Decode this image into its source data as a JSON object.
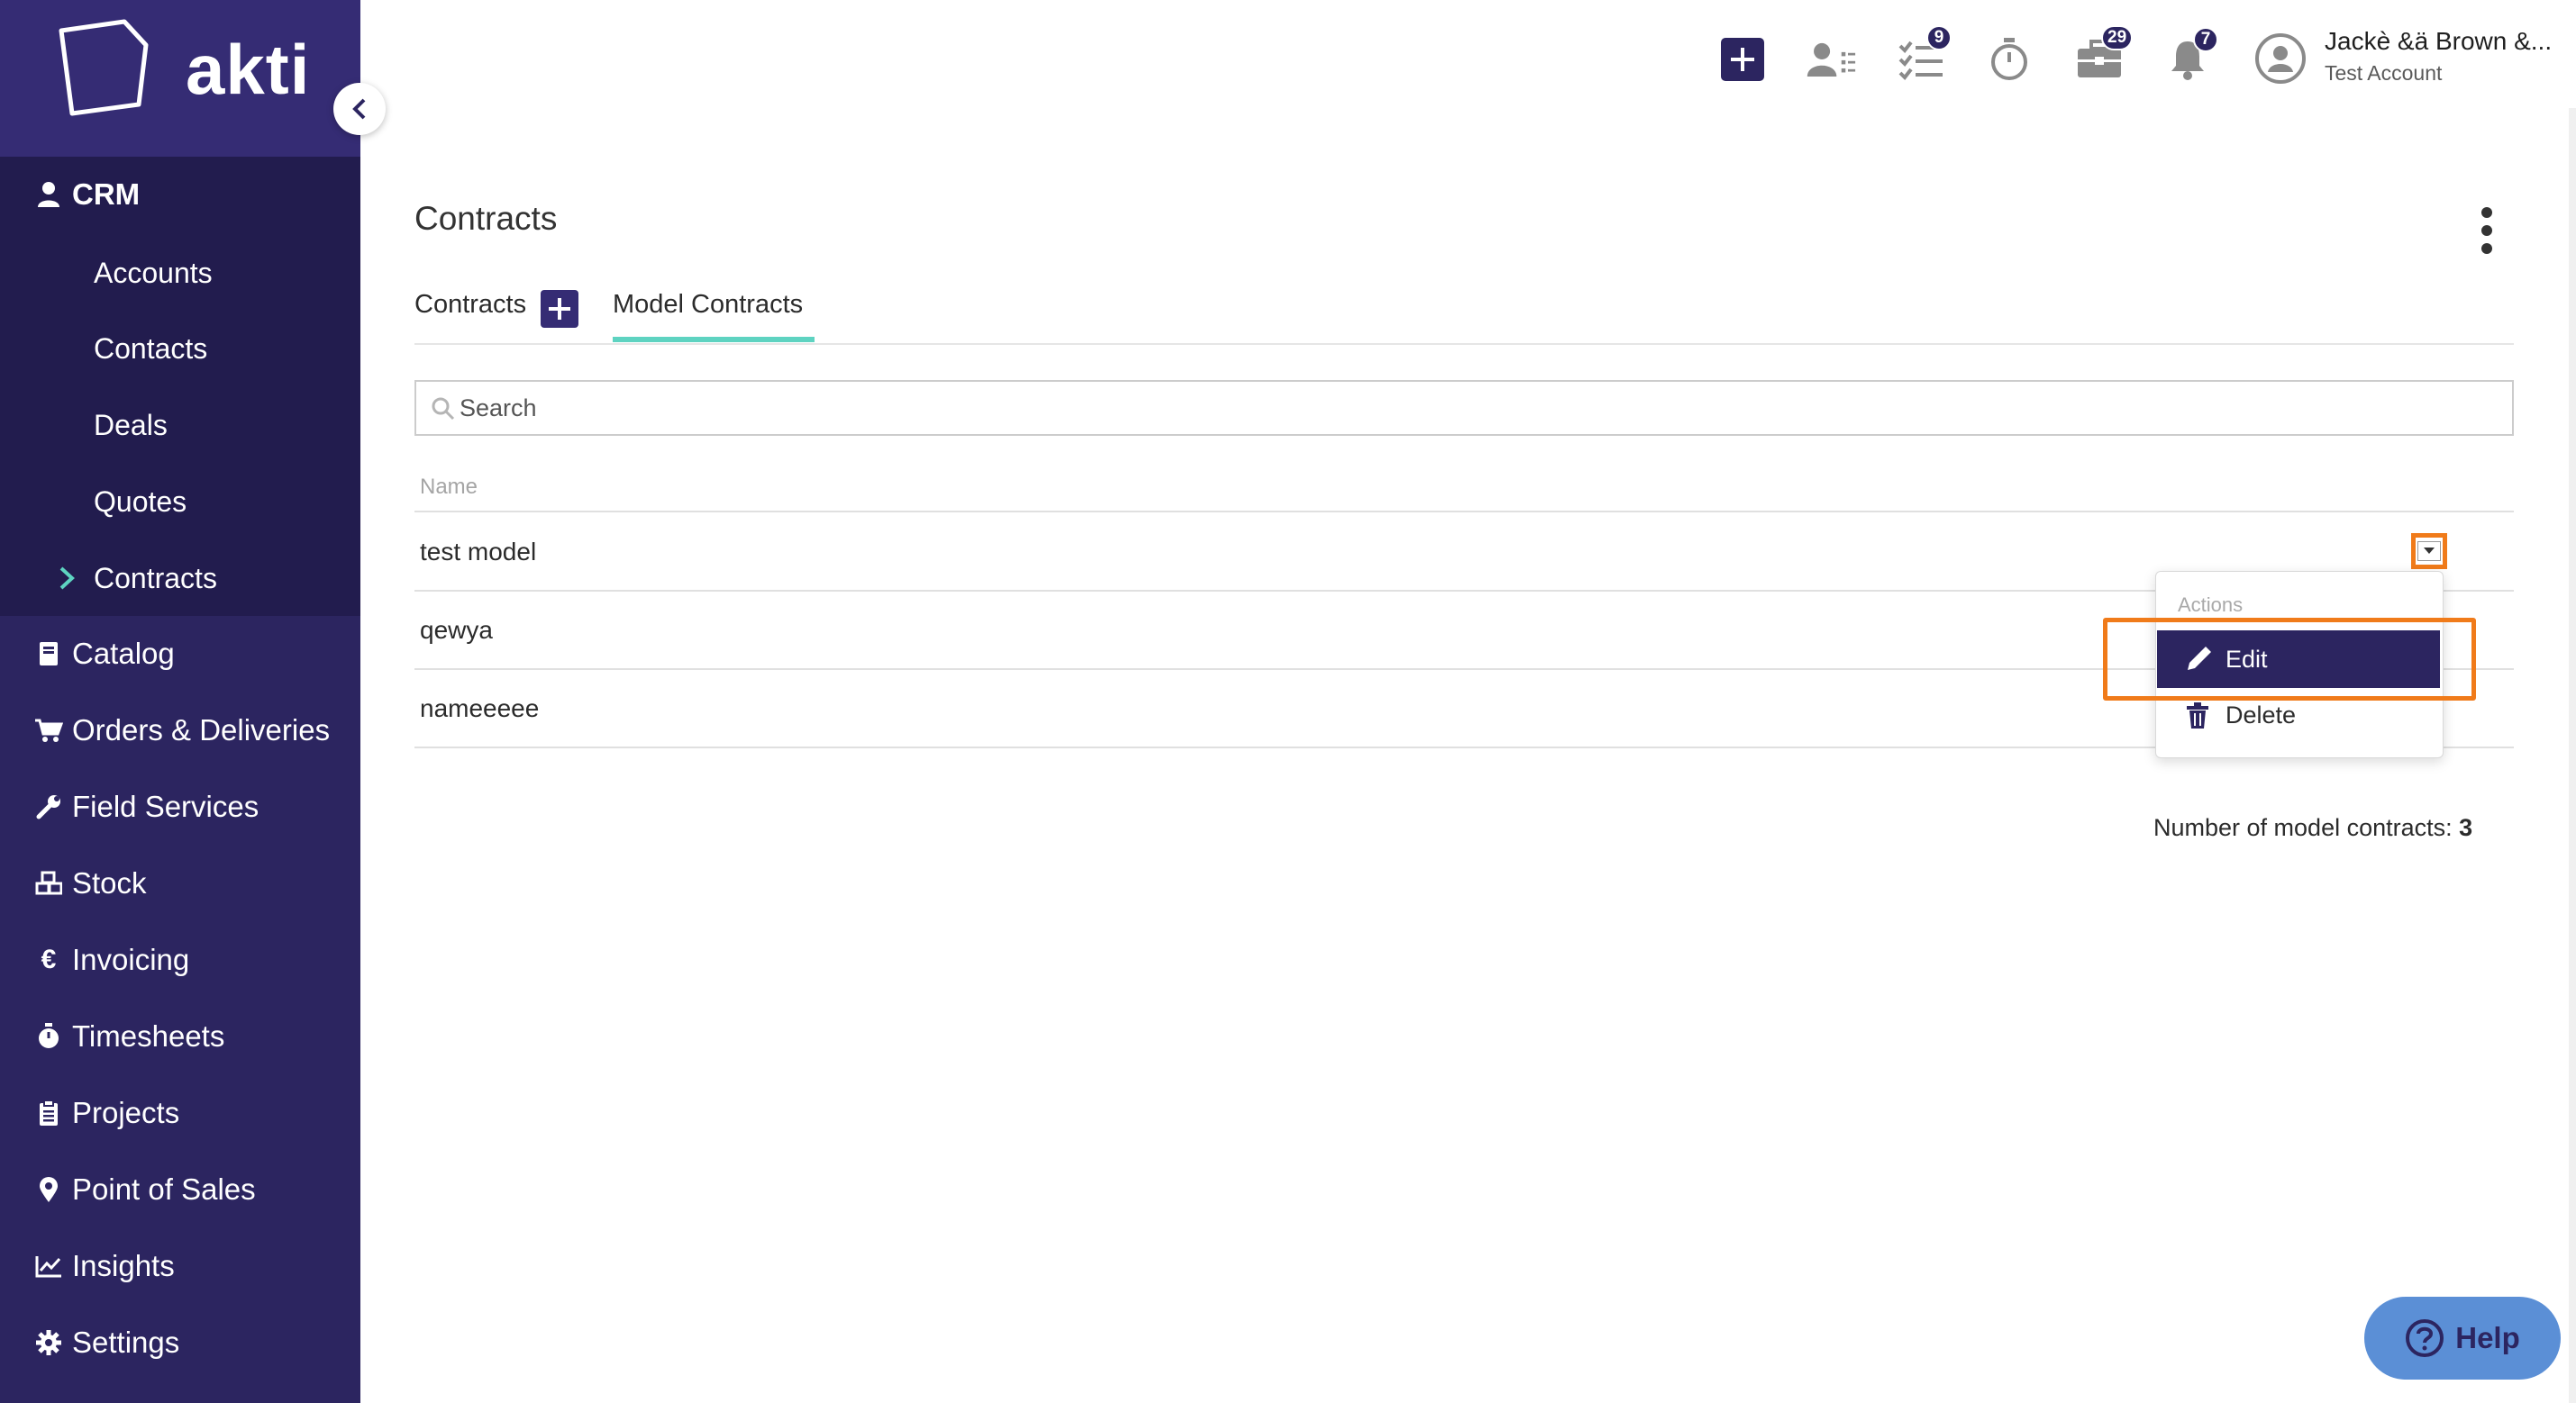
{
  "app": {
    "logo_text": "akti"
  },
  "sidebar": {
    "crm_label": "CRM",
    "crm_items": [
      "Accounts",
      "Contacts",
      "Deals",
      "Quotes",
      "Contracts"
    ],
    "active_item": "Contracts",
    "items": [
      {
        "label": "Catalog",
        "icon": "book-icon"
      },
      {
        "label": "Orders & Deliveries",
        "icon": "cart-icon"
      },
      {
        "label": "Field Services",
        "icon": "wrench-icon"
      },
      {
        "label": "Stock",
        "icon": "boxes-icon"
      },
      {
        "label": "Invoicing",
        "icon": "euro-icon"
      },
      {
        "label": "Timesheets",
        "icon": "stopwatch-icon"
      },
      {
        "label": "Projects",
        "icon": "clipboard-icon"
      },
      {
        "label": "Point of Sales",
        "icon": "map-pin-icon"
      },
      {
        "label": "Insights",
        "icon": "chart-line-icon"
      },
      {
        "label": "Settings",
        "icon": "gear-icon"
      }
    ]
  },
  "topbar": {
    "tasks_badge": "9",
    "briefcase_badge": "29",
    "notifications_badge": "7",
    "user_name": "Jackè &ä Brown &...",
    "user_account": "Test Account"
  },
  "page": {
    "title": "Contracts",
    "tabs": [
      "Contracts",
      "Model Contracts"
    ],
    "active_tab": "Model Contracts",
    "search_placeholder": "Search",
    "column_name": "Name",
    "rows": [
      "test model",
      "qewya",
      "nameeeee"
    ],
    "count_label": "Number of model contracts:",
    "count_value": "3"
  },
  "actions_menu": {
    "header": "Actions",
    "edit_label": "Edit",
    "delete_label": "Delete"
  },
  "help": {
    "label": "Help"
  },
  "colors": {
    "sidebar": "#2c2560",
    "sidebar_dark": "#221c4e",
    "accent_teal": "#5ed3c1",
    "highlight_orange": "#f07b1a",
    "help_blue": "#5b8fd6"
  }
}
